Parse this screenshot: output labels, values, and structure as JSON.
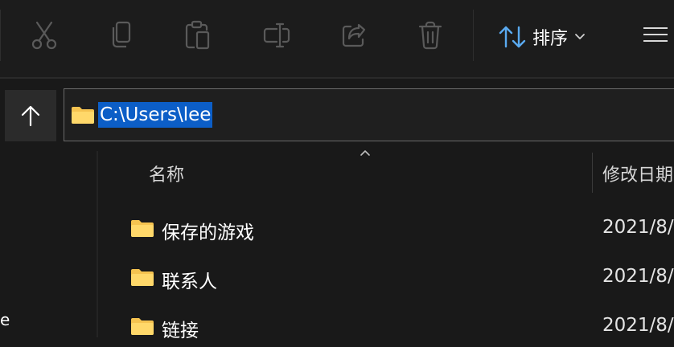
{
  "toolbar": {
    "buttons": [
      {
        "name": "cut",
        "icon": "scissors-icon"
      },
      {
        "name": "copy",
        "icon": "copy-icon"
      },
      {
        "name": "paste",
        "icon": "clipboard-icon"
      },
      {
        "name": "rename",
        "icon": "rename-icon"
      },
      {
        "name": "share",
        "icon": "share-icon"
      },
      {
        "name": "delete",
        "icon": "trash-icon"
      }
    ],
    "sort_label": "排序",
    "more_icon": "view-lines-icon"
  },
  "address_bar": {
    "path": "C:\\Users\\lee",
    "selected": true,
    "accent_color": "#0c5ec7"
  },
  "nav_pane": {
    "fragments": [
      "e"
    ]
  },
  "columns": {
    "name": "名称",
    "modified": "修改日期"
  },
  "files": [
    {
      "name": "保存的游戏",
      "modified": "2021/8/"
    },
    {
      "name": "联系人",
      "modified": "2021/8/"
    },
    {
      "name": "链接",
      "modified": "2021/8/"
    }
  ],
  "colors": {
    "background": "#191919",
    "toolbar": "#1c1c1c",
    "folder": "#f5c350",
    "icon_muted": "#5a5a5a"
  }
}
